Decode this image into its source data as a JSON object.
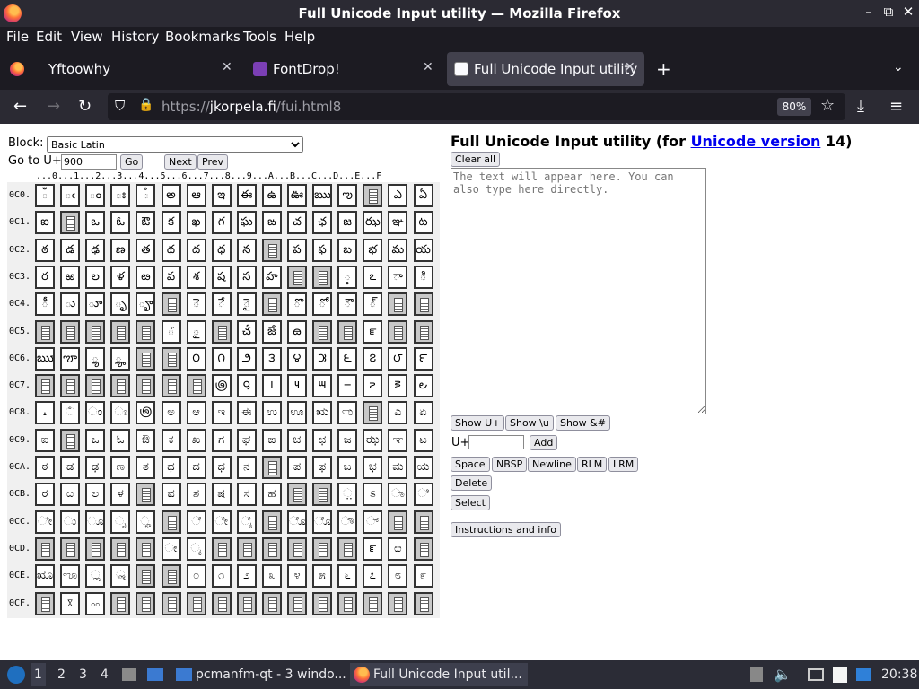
{
  "window": {
    "title": "Full Unicode Input utility — Mozilla Firefox"
  },
  "menubar": [
    "File",
    "Edit",
    "View",
    "History",
    "Bookmarks",
    "Tools",
    "Help"
  ],
  "tabs": [
    {
      "label": "Yftoowhy",
      "active": false
    },
    {
      "label": "FontDrop!",
      "active": false
    },
    {
      "label": "Full Unicode Input utility",
      "active": true
    }
  ],
  "navbar": {
    "url_scheme": "https://",
    "url_host": "jkorpela.fi",
    "url_path": "/fui.html8",
    "zoom": "80%"
  },
  "page": {
    "block_label": "Block:",
    "block_value": "Basic Latin",
    "goto_label": "Go to U+",
    "goto_value": "900",
    "go_button": "Go",
    "next_button": "Next",
    "prev_button": "Prev",
    "column_headers": "...0...1...2...3...4...5...6...7...8...9...A...B...C...D...E...F",
    "title_prefix": "Full Unicode Input utility (for ",
    "title_link": "Unicode version",
    "title_suffix": " 14)",
    "clear_all": "Clear all",
    "textarea_placeholder": "The text will appear here. You can also type here directly.",
    "show_uplus": "Show U+",
    "show_u": "Show \\u",
    "show_amp": "Show &#",
    "uplus_label": "U+",
    "add_button": "Add",
    "space_button": "Space",
    "nbsp_button": "NBSP",
    "newline_button": "Newline",
    "rlm_button": "RLM",
    "lrm_button": "LRM",
    "delete_button": "Delete",
    "select_button": "Select",
    "instructions_button": "Instructions and info"
  },
  "grid": {
    "rows": [
      "0C0.",
      "0C1.",
      "0C2.",
      "0C3.",
      "0C4.",
      "0C5.",
      "0C6.",
      "0C7.",
      "0C8.",
      "0C9.",
      "0CA.",
      "0CB.",
      "0CC.",
      "0CD.",
      "0CE.",
      "0CF."
    ],
    "cells": [
      [
        "ఀ",
        "ఁ",
        "ం",
        "ః",
        "ఄ",
        "అ",
        "ఆ",
        "ఇ",
        "ఈ",
        "ఉ",
        "ఊ",
        "ఋ",
        "ఌ",
        "",
        "ఎ",
        "ఏ"
      ],
      [
        "ఐ",
        "",
        "ఒ",
        "ఓ",
        "ఔ",
        "క",
        "ఖ",
        "గ",
        "ఘ",
        "ఙ",
        "చ",
        "ఛ",
        "జ",
        "ఝ",
        "ఞ",
        "ట"
      ],
      [
        "ఠ",
        "డ",
        "ఢ",
        "ణ",
        "త",
        "థ",
        "ద",
        "ధ",
        "న",
        "",
        "ప",
        "ఫ",
        "బ",
        "భ",
        "మ",
        "య"
      ],
      [
        "ర",
        "ఱ",
        "ల",
        "ళ",
        "ఴ",
        "వ",
        "శ",
        "ష",
        "స",
        "హ",
        "",
        "",
        "఼",
        "ఽ",
        "ా",
        "ి"
      ],
      [
        "ీ",
        "ు",
        "ూ",
        "ృ",
        "ౄ",
        "",
        "ె",
        "ే",
        "ై",
        "",
        "ొ",
        "ో",
        "ౌ",
        "్",
        "",
        ""
      ],
      [
        "",
        "",
        "",
        "",
        "",
        "ౕ",
        "ౖ",
        "",
        "ౘ",
        "ౙ",
        "ౚ",
        "",
        "",
        "ౝ",
        "",
        ""
      ],
      [
        "ౠ",
        "ౡ",
        "ౢ",
        "ౣ",
        "",
        "",
        "౦",
        "౧",
        "౨",
        "౩",
        "౪",
        "౫",
        "౬",
        "౭",
        "౮",
        "౯"
      ],
      [
        "",
        "",
        "",
        "",
        "",
        "",
        "",
        "౷",
        "౸",
        "౹",
        "౺",
        "౻",
        "౼",
        "౽",
        "౾",
        "౿"
      ],
      [
        "ಀ",
        "ಁ",
        "ಂ",
        "ಃ",
        "಄",
        "ಅ",
        "ಆ",
        "ಇ",
        "ಈ",
        "ಉ",
        "ಊ",
        "ಋ",
        "ಌ",
        "",
        "ಎ",
        "ಏ"
      ],
      [
        "ಐ",
        "",
        "ಒ",
        "ಓ",
        "ಔ",
        "ಕ",
        "ಖ",
        "ಗ",
        "ಘ",
        "ಙ",
        "ಚ",
        "ಛ",
        "ಜ",
        "ಝ",
        "ಞ",
        "ಟ"
      ],
      [
        "ಠ",
        "ಡ",
        "ಢ",
        "ಣ",
        "ತ",
        "ಥ",
        "ದ",
        "ಧ",
        "ನ",
        "",
        "ಪ",
        "ಫ",
        "ಬ",
        "ಭ",
        "ಮ",
        "ಯ"
      ],
      [
        "ರ",
        "ಱ",
        "ಲ",
        "ಳ",
        "",
        "ವ",
        "ಶ",
        "ಷ",
        "ಸ",
        "ಹ",
        "",
        "",
        "಼",
        "ಽ",
        "ಾ",
        "ಿ"
      ],
      [
        "ೀ",
        "ು",
        "ೂ",
        "ೃ",
        "ೄ",
        "",
        "ೆ",
        "ೇ",
        "ೈ",
        "",
        "ೊ",
        "ೋ",
        "ೌ",
        "್",
        "",
        ""
      ],
      [
        "",
        "",
        "",
        "",
        "",
        "ೕ",
        "ೖ",
        "",
        "",
        "",
        "",
        "",
        "",
        "ೝ",
        "ೞ",
        ""
      ],
      [
        "ೠ",
        "ೡ",
        "ೢ",
        "ೣ",
        "",
        "",
        "೦",
        "೧",
        "೨",
        "೩",
        "೪",
        "೫",
        "೬",
        "೭",
        "೮",
        "೯"
      ],
      [
        "",
        "ೱ",
        "ೲ",
        "",
        "",
        "",
        "",
        "",
        "",
        "",
        "",
        "",
        "",
        "",
        "",
        ""
      ]
    ]
  },
  "taskbar": {
    "workspaces": [
      "1",
      "2",
      "3",
      "4"
    ],
    "tasks": [
      {
        "label": "pcmanfm-qt - 3 windo..."
      },
      {
        "label": "Full Unicode Input util..."
      }
    ],
    "clock": "20:38"
  },
  "colors": {
    "chrome_dark": "#1c1b22",
    "chrome_mid": "#2b2a33",
    "tab_active": "#42414d",
    "link": "#0000ee"
  }
}
